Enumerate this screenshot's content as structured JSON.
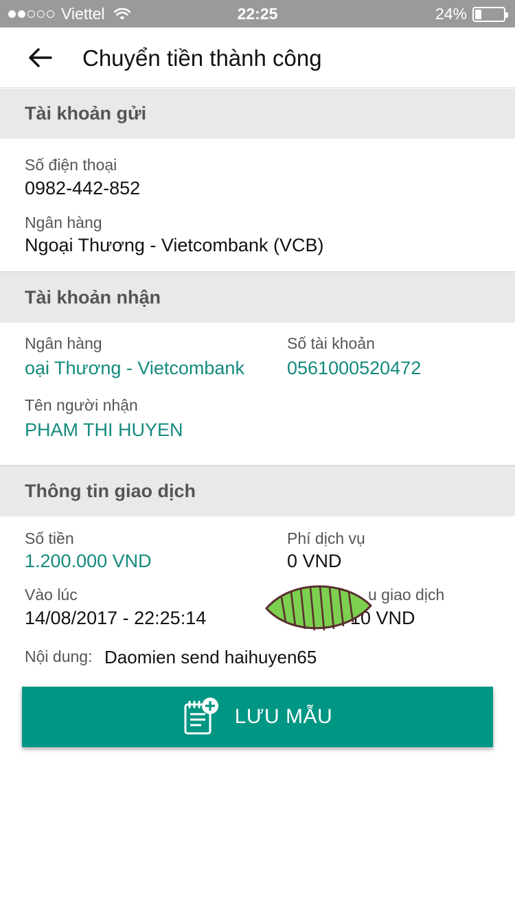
{
  "status_bar": {
    "carrier": "Viettel",
    "time": "22:25",
    "battery": "24%",
    "battery_level": 0.24,
    "signal_bars_filled": 2,
    "signal_bars_total": 5
  },
  "header": {
    "title": "Chuyển tiền thành công"
  },
  "sender": {
    "section_title": "Tài khoản gửi",
    "phone_label": "Số điện thoại",
    "phone_value": "0982-442-852",
    "bank_label": "Ngân hàng",
    "bank_value": "Ngoại Thương - Vietcombank (VCB)"
  },
  "receiver": {
    "section_title": "Tài khoản nhận",
    "bank_label": "Ngân hàng",
    "bank_value": "oại Thương - Vietcombank",
    "account_label": "Số tài khoản",
    "account_value": "0561000520472",
    "name_label": "Tên người nhận",
    "name_value": "PHAM THI HUYEN"
  },
  "transaction": {
    "section_title": "Thông tin giao dịch",
    "amount_label": "Số tiền",
    "amount_value": "1.200.000 VND",
    "fee_label": "Phí dịch vụ",
    "fee_value": "0 VND",
    "time_label": "Vào lúc",
    "time_value": "14/08/2017 - 22:25:14",
    "code_label": "u giao dịch",
    "code_value": "10 VND",
    "content_label": "Nội dung:",
    "content_value": "Daomien send haihuyen65"
  },
  "actions": {
    "save_template_label": "LƯU MẪU"
  },
  "colors": {
    "accent": "#009684",
    "teal_text": "#138a7d",
    "section_bg": "#e9e9e9",
    "status_bar_bg": "#9a9a9a",
    "sticker_green": "#7ccf4f"
  },
  "icons": {
    "back": "arrow-left-icon",
    "save": "note-add-icon",
    "wifi": "wifi-icon",
    "battery": "battery-icon"
  }
}
